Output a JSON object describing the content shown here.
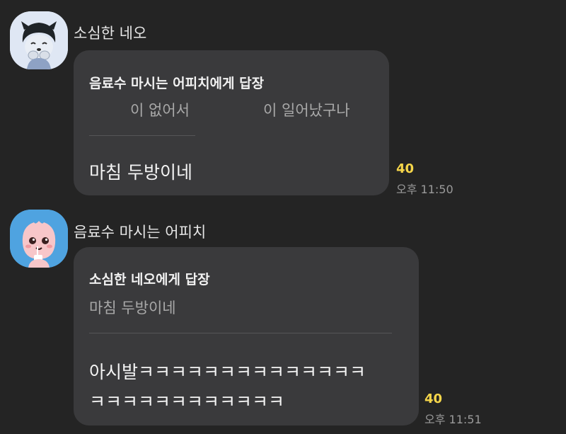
{
  "messages": [
    {
      "sender": "소심한 네오",
      "avatar_icon": "neo-character-icon",
      "reply_header": "음료수 마시는 어피치에게 답장",
      "quoted_text_1": "이 없어서",
      "quoted_text_2": "이 일어났구나",
      "body": "마침 두방이네",
      "unread_count": "40",
      "time": "오후 11:50"
    },
    {
      "sender": "음료수 마시는 어피치",
      "avatar_icon": "apeach-character-icon",
      "reply_header": "소심한 네오에게 답장",
      "quoted_text": "마침 두방이네",
      "body_line_1": "아시발ㅋㅋㅋㅋㅋㅋㅋㅋㅋㅋㅋㅋㅋㅋ",
      "body_line_2": "ㅋㅋㅋㅋㅋㅋㅋㅋㅋㅋㅋㅋ",
      "unread_count": "40",
      "time": "오후 11:51"
    }
  ],
  "colors": {
    "background": "#242424",
    "bubble": "#3a3a3c",
    "unread": "#f6d64a",
    "time": "#9a9a9a",
    "quoted": "#a9a9a9"
  }
}
